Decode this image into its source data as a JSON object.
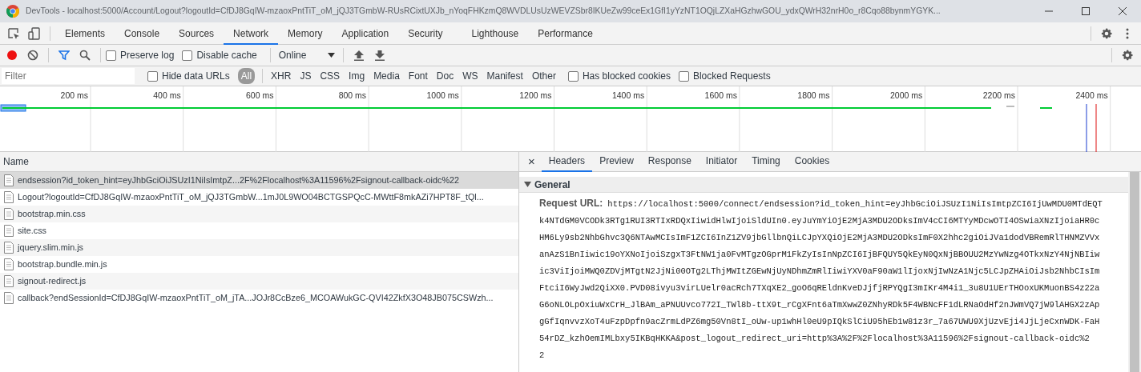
{
  "window": {
    "title": "DevTools - localhost:5000/Account/Logout?logoutId=CfDJ8GqIW-mzaoxPntTiT_oM_jQJ3TGmbW-RUsRCixtUXJb_nYoqFHKzmQ8WVDLUsUzWEVZSbr8IKUeZw99ceEx1GfI1yYzNT1OQjLZXaHGzhwGOU_ydxQWrH32nrH0o_r8Cqo88bynmYGYK..."
  },
  "panel_tabs": [
    {
      "label": "Elements",
      "selected": false
    },
    {
      "label": "Console",
      "selected": false
    },
    {
      "label": "Sources",
      "selected": false
    },
    {
      "label": "Network",
      "selected": true
    },
    {
      "label": "Memory",
      "selected": false
    },
    {
      "label": "Application",
      "selected": false
    },
    {
      "label": "Security",
      "selected": false
    },
    {
      "label": "Lighthouse",
      "selected": false
    },
    {
      "label": "Performance",
      "selected": false
    }
  ],
  "toolbar": {
    "recording": true,
    "filter_on": true,
    "preserve_log": {
      "label": "Preserve log",
      "checked": false
    },
    "disable_cache": {
      "label": "Disable cache",
      "checked": false
    },
    "throttling": "Online"
  },
  "filter_bar": {
    "placeholder": "Filter",
    "hide_data_urls": {
      "label": "Hide data URLs",
      "checked": false
    },
    "types": [
      {
        "label": "All",
        "selected": true
      },
      {
        "label": "XHR",
        "selected": false
      },
      {
        "label": "JS",
        "selected": false
      },
      {
        "label": "CSS",
        "selected": false
      },
      {
        "label": "Img",
        "selected": false
      },
      {
        "label": "Media",
        "selected": false
      },
      {
        "label": "Font",
        "selected": false
      },
      {
        "label": "Doc",
        "selected": false
      },
      {
        "label": "WS",
        "selected": false
      },
      {
        "label": "Manifest",
        "selected": false
      },
      {
        "label": "Other",
        "selected": false
      }
    ],
    "has_blocked_cookies": {
      "label": "Has blocked cookies",
      "checked": false
    },
    "blocked_requests": {
      "label": "Blocked Requests",
      "checked": false
    }
  },
  "overview": {
    "ticks": [
      "200 ms",
      "400 ms",
      "600 ms",
      "800 ms",
      "1000 ms",
      "1200 ms",
      "1400 ms",
      "1600 ms",
      "1800 ms",
      "2000 ms",
      "2200 ms",
      "2400 ms"
    ]
  },
  "requests": {
    "column": "Name",
    "rows": [
      {
        "name": "endsession?id_token_hint=eyJhbGciOiJSUzI1NiIsImtpZ...2F%2Flocalhost%3A11596%2Fsignout-callback-oidc%22",
        "selected": true
      },
      {
        "name": "Logout?logoutId=CfDJ8GqIW-mzaoxPntTiT_oM_jQJ3TGmbW...1mJ0L9WO04BCTGSPQcC-MWttF8mkAZi7HPT8F_tQl...",
        "selected": false
      },
      {
        "name": "bootstrap.min.css",
        "selected": false
      },
      {
        "name": "site.css",
        "selected": false
      },
      {
        "name": "jquery.slim.min.js",
        "selected": false
      },
      {
        "name": "bootstrap.bundle.min.js",
        "selected": false
      },
      {
        "name": "signout-redirect.js",
        "selected": false
      },
      {
        "name": "callback?endSessionId=CfDJ8GqIW-mzaoxPntTiT_oM_jTA...JOJr8CcBze6_MCOAWukGC-QVI42ZkfX3O48JB075CSWzh...",
        "selected": false
      }
    ]
  },
  "details": {
    "close": "×",
    "tabs": [
      {
        "label": "Headers",
        "selected": true
      },
      {
        "label": "Preview",
        "selected": false
      },
      {
        "label": "Response",
        "selected": false
      },
      {
        "label": "Initiator",
        "selected": false
      },
      {
        "label": "Timing",
        "selected": false
      },
      {
        "label": "Cookies",
        "selected": false
      }
    ],
    "section": {
      "title": "General",
      "expanded": true,
      "label": "Request URL:",
      "value_lines": [
        "https://localhost:5000/connect/endsession?id_token_hint=eyJhbGciOiJSUzI1NiIsImtpZCI6IjUwMDU0MTdEQT",
        "k4NTdGM0VCODk3RTg1RUI3RTIxRDQxIiwidHlwIjoiSldUIn0.eyJuYmYiOjE2MjA3MDU2ODksImV4cCI6MTYyMDcwOTI4OSwiaXNzIjoiaHR0c",
        "HM6Ly9sb2NhbGhvc3Q6NTAwMCIsImF1ZCI6InZ1ZV9jbGllbnQiLCJpYXQiOjE2MjA3MDU2ODksImF0X2hhc2giOiJVa1dodVBRemRlTHNMZVVx",
        "anAzS1BnIiwic19oYXNoIjoiSzgxT3FtNW1ja0FvMTgzOGprM1FkZyIsInNpZCI6IjBFQUY5QkEyN0QxNjBBOUU2MzYwNzg4OTkxNzY4NjNBIiw",
        "ic3ViIjoiMWQ0ZDVjMTgtN2JjNi00OTg2LThjMWItZGEwNjUyNDhmZmRlIiwiYXV0aF90aW1lIjoxNjIwNzA1Njc5LCJpZHAiOiJsb2NhbCIsIm",
        "FtciI6WyJwd2QiXX0.PVD08ivyu3virLUelr0acRch7TXqXE2_goO6qREldnKveDJjfjRPYQgI3mIKr4M4i1_3u8U1UErTHOoxUKMuonBS4z22a",
        "G6oNLOLpOxiuWxCrH_JlBAm_aPNUUvco772I_TWl8b-ttX9t_rCgXFnt6aTmXwwZ0ZNhyRDk5F4WBNcFF1dLRNaOdHf2nJWmVQ7jW9lAHGX2zAp",
        "gGfIqnvvzXoT4uFzpDpfn9acZrmLdPZ6mg50Vn8tI_oUw-up1whHl0eU9pIQkSlCiU95hEb1w81z3r_7a67UWU9XjUzvEji4JjLjeCxnWDK-FaH",
        "54rDZ_kzhOemIMLbxy5IKBqHKKA&post_logout_redirect_uri=http%3A%2F%2Flocalhost%3A11596%2Fsignout-callback-oidc%2",
        "2"
      ]
    }
  }
}
